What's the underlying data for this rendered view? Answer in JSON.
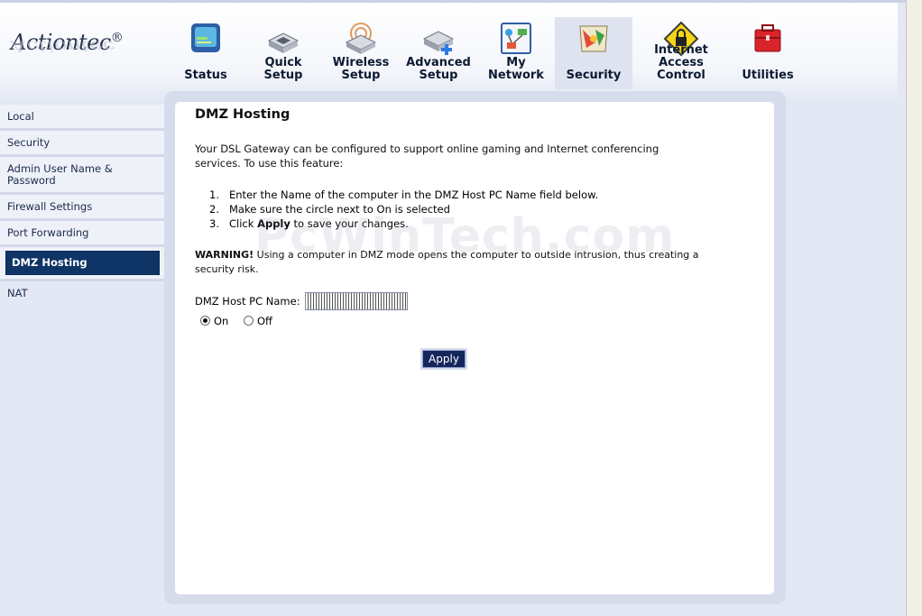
{
  "header": {
    "logo_text": "Actiontec",
    "logo_reg": "®",
    "tabs": [
      {
        "label": "Status",
        "icon": "status-monitor-icon"
      },
      {
        "label": "Quick\nSetup",
        "icon": "quick-setup-router-icon"
      },
      {
        "label": "Wireless\nSetup",
        "icon": "wireless-router-icon"
      },
      {
        "label": "Advanced\nSetup",
        "icon": "advanced-setup-router-icon"
      },
      {
        "label": "My Network",
        "icon": "network-diagram-icon"
      },
      {
        "label": "Security",
        "icon": "security-shield-icon"
      },
      {
        "label": "Internet Access\nControl",
        "icon": "lock-warning-icon"
      },
      {
        "label": "Utilities",
        "icon": "toolbox-icon"
      }
    ]
  },
  "sidebar": {
    "items": [
      {
        "label": "Local"
      },
      {
        "label": "Security"
      },
      {
        "label": "Admin User Name &\nPassword"
      },
      {
        "label": "Firewall Settings"
      },
      {
        "label": "Port Forwarding"
      },
      {
        "label": "DMZ Hosting"
      },
      {
        "label": "NAT"
      }
    ]
  },
  "main": {
    "title": "DMZ Hosting",
    "intro": "Your DSL Gateway can be configured to support online gaming and Internet conferencing services. To use this feature:",
    "steps": [
      {
        "num": "1.",
        "text": "Enter the Name of the computer in the DMZ Host PC Name field below."
      },
      {
        "num": "2.",
        "text": "Make sure the circle next to On is selected"
      },
      {
        "num": "3.",
        "pre": "Click ",
        "bold": "Apply",
        "post": " to save your changes."
      }
    ],
    "warning_label": "WARNING!",
    "warning_text": " Using a computer in DMZ mode opens the computer to outside intrusion, thus creating a security risk.",
    "host_label": "DMZ Host PC Name:",
    "host_value": "",
    "radio_on": "On",
    "radio_off": "Off",
    "apply_label": "Apply",
    "watermark": "PcWinTech.com"
  },
  "colors": {
    "accent": "#0f3566",
    "panel": "#d6dcec",
    "page_bg": "#e3e8f4"
  }
}
